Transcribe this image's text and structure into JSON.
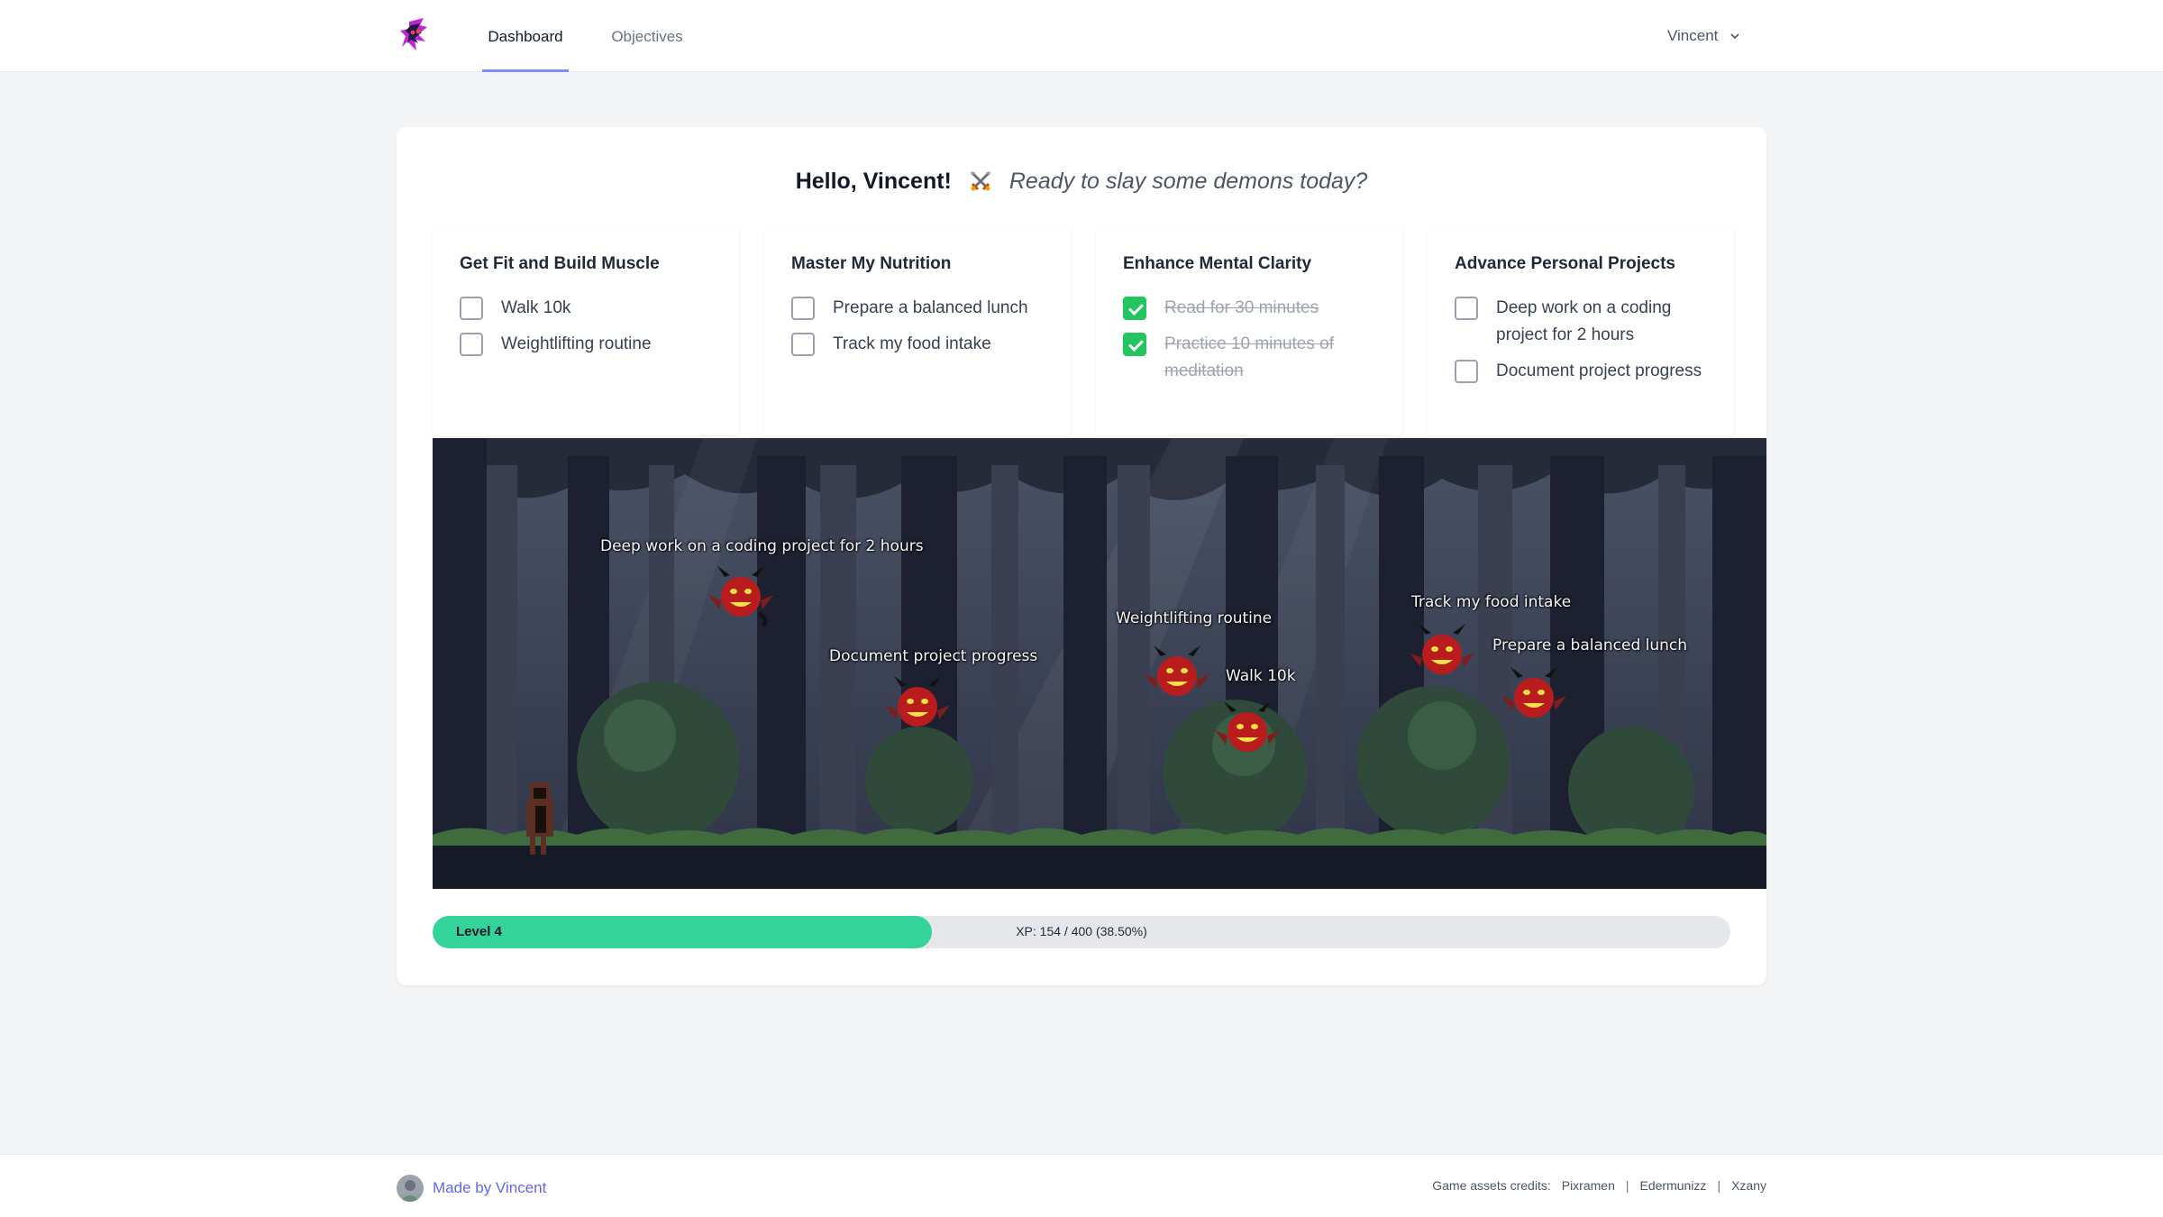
{
  "nav": {
    "tabs": [
      {
        "label": "Dashboard",
        "active": true
      },
      {
        "label": "Objectives",
        "active": false
      }
    ],
    "user_name": "Vincent"
  },
  "greeting": {
    "hello": "Hello, Vincent!",
    "tagline": "Ready to slay some demons today?"
  },
  "objectives": [
    {
      "title": "Get Fit and Build Muscle",
      "tasks": [
        {
          "label": "Walk 10k",
          "done": false
        },
        {
          "label": "Weightlifting routine",
          "done": false
        }
      ]
    },
    {
      "title": "Master My Nutrition",
      "tasks": [
        {
          "label": "Prepare a balanced lunch",
          "done": false
        },
        {
          "label": "Track my food intake",
          "done": false
        }
      ]
    },
    {
      "title": "Enhance Mental Clarity",
      "tasks": [
        {
          "label": "Read for 30 minutes",
          "done": true
        },
        {
          "label": "Practice 10 minutes of meditation",
          "done": true
        }
      ]
    },
    {
      "title": "Advance Personal Projects",
      "tasks": [
        {
          "label": "Deep work on a coding project for 2 hours",
          "done": false
        },
        {
          "label": "Document project progress",
          "done": false
        }
      ]
    }
  ],
  "game": {
    "enemies": [
      {
        "label": "Deep work on a coding project for 2 hours"
      },
      {
        "label": "Document project progress"
      },
      {
        "label": "Weightlifting routine"
      },
      {
        "label": "Walk 10k"
      },
      {
        "label": "Track my food intake"
      },
      {
        "label": "Prepare a balanced lunch"
      }
    ]
  },
  "xp": {
    "level_label": "Level 4",
    "text": "XP: 154 / 400 (38.50%)",
    "fraction": 0.385
  },
  "footer": {
    "made_by": "Made by Vincent",
    "credits_label": "Game assets credits:",
    "credits": [
      "Pixramen",
      "Edermunizz",
      "Xzany"
    ],
    "separator": "|"
  },
  "colors": {
    "accent": "#818cf8",
    "xp_fill": "#34d399",
    "check_done": "#22c55e",
    "link": "#6366f1"
  }
}
